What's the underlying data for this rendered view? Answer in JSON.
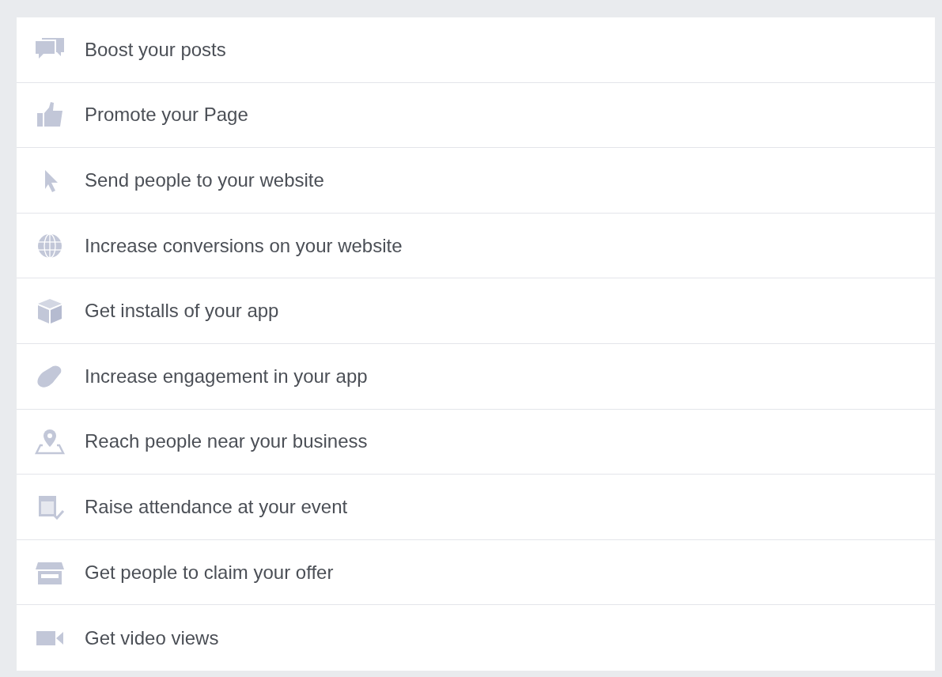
{
  "objectives": [
    {
      "label": "Boost your posts"
    },
    {
      "label": "Promote your Page"
    },
    {
      "label": "Send people to your website"
    },
    {
      "label": "Increase conversions on your website"
    },
    {
      "label": "Get installs of your app"
    },
    {
      "label": "Increase engagement in your app"
    },
    {
      "label": "Reach people near your business"
    },
    {
      "label": "Raise attendance at your event"
    },
    {
      "label": "Get people to claim your offer"
    },
    {
      "label": "Get video views"
    }
  ]
}
